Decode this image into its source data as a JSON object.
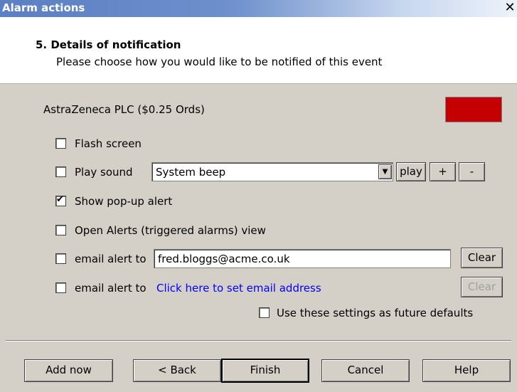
{
  "window": {
    "title": "Alarm actions",
    "close_glyph": "✕"
  },
  "header": {
    "heading": "5. Details of notification",
    "subheading": "Please choose how you would like to be notified of this event"
  },
  "instrument": {
    "name": "AstraZeneca PLC ($0.25 Ords)",
    "color": "#c40000"
  },
  "options": {
    "flash_screen": {
      "label": "Flash screen",
      "checked": false
    },
    "play_sound": {
      "label": "Play sound",
      "checked": false,
      "sound": "System beep",
      "play_label": "play",
      "plus_label": "+",
      "minus_label": "-"
    },
    "popup": {
      "label": "Show pop-up alert",
      "checked": true
    },
    "open_alerts": {
      "label": "Open Alerts (triggered alarms) view",
      "checked": false
    },
    "email1": {
      "label": "email alert to",
      "checked": false,
      "value": "fred.bloggs@acme.co.uk",
      "clear_label": "Clear"
    },
    "email2": {
      "label": "email alert to",
      "checked": false,
      "link": "Click here to set email address",
      "clear_label": "Clear"
    },
    "defaults": {
      "label": "Use these settings as future defaults",
      "checked": false
    }
  },
  "footer": {
    "add_now": "Add now",
    "back": "< Back",
    "finish": "Finish",
    "cancel": "Cancel",
    "help": "Help"
  }
}
